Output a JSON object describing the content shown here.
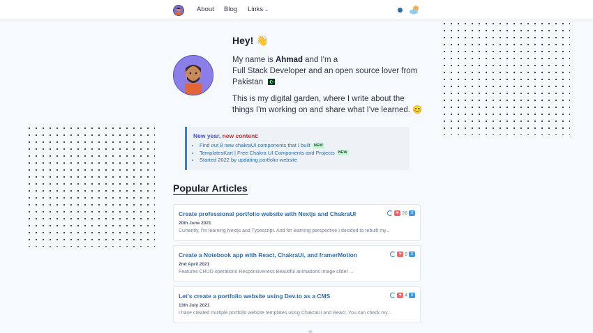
{
  "nav": {
    "links": [
      "About",
      "Blog",
      "Links"
    ],
    "links_chevron": "⌄"
  },
  "hero": {
    "greeting": "Hey! 👋",
    "intro_prefix": "My name is ",
    "name": "Ahmad",
    "intro_suffix": " and I'm a",
    "role": "Full Stack Developer and an open source lover from",
    "country": "Pakistan",
    "garden": "This is my digital garden, where I write about the things I'm working on and share what I've learned. 😊"
  },
  "callout": {
    "title_part1": "New year, ",
    "title_part2": "new content:",
    "items": [
      {
        "text": "Find out 8 new chakraUI components that I built",
        "badge": "NEW"
      },
      {
        "text": "TemplatesKart | Free Chakra UI Components and Projects",
        "badge": "NEW"
      },
      {
        "text": "Started 2022 by updating portfolio website",
        "badge": ""
      }
    ]
  },
  "popular_title": "Popular Articles",
  "articles": [
    {
      "title": "Create professional portfolio website with Nextjs and ChakraUI",
      "date": "20th June 2021",
      "excerpt": "Currently, I'm learning Nextjs and Typescript. And for learning perspective I decided to rebuilt my...",
      "count": "26"
    },
    {
      "title": "Create a Notebook app with React, ChakraUi, and framerMotion",
      "date": "2nd April 2021",
      "excerpt": "Features CRUD operations Responsiveness Beautiful animations Image slider ...",
      "count": "6"
    },
    {
      "title": "Let's create a portfolio website using Dev.to as a CMS",
      "date": "13th July 2021",
      "excerpt": "I have created multiple portfolio website templates using ChakraUI and React. You can check my...",
      "count": "4"
    }
  ],
  "colors": {
    "accent": "#2b6cb0",
    "heart": "#f56565",
    "comment": "#4299e1"
  }
}
